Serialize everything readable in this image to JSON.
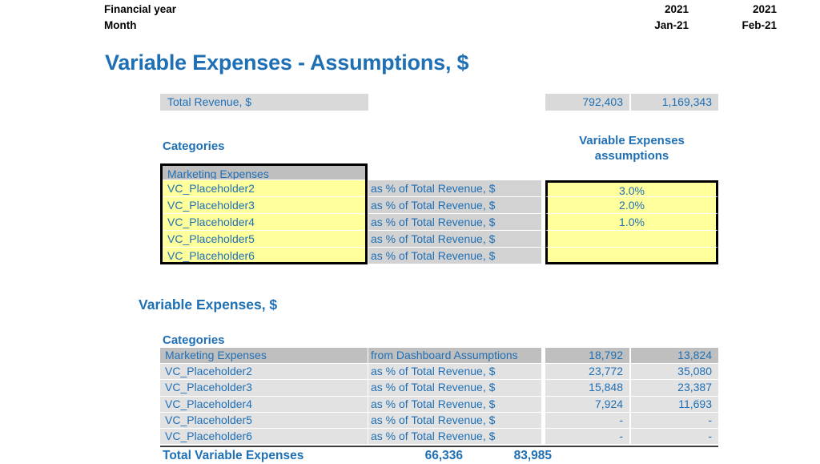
{
  "header": {
    "financial_year_label": "Financial year",
    "month_label": "Month",
    "columns": [
      {
        "year": "2021",
        "month": "Jan-21"
      },
      {
        "year": "2021",
        "month": "Feb-21"
      }
    ]
  },
  "page_title": "Variable Expenses - Assumptions, $",
  "revenue": {
    "label": "Total Revenue, $",
    "values": [
      "792,403",
      "1,169,343"
    ]
  },
  "assumptions": {
    "categories_header": "Categories",
    "values_header_line1": "Variable Expenses",
    "values_header_line2": "assumptions",
    "rows": [
      {
        "name": "Marketing Expenses",
        "basis": "",
        "value": ""
      },
      {
        "name": "VC_Placeholder2",
        "basis": "as % of Total Revenue, $",
        "value": "3.0%"
      },
      {
        "name": "VC_Placeholder3",
        "basis": "as % of Total Revenue, $",
        "value": "2.0%"
      },
      {
        "name": "VC_Placeholder4",
        "basis": "as % of Total Revenue, $",
        "value": "1.0%"
      },
      {
        "name": "VC_Placeholder5",
        "basis": "as % of Total Revenue, $",
        "value": ""
      },
      {
        "name": "VC_Placeholder6",
        "basis": "as % of Total Revenue, $",
        "value": ""
      }
    ]
  },
  "variable_expenses": {
    "section_title": "Variable Expenses, $",
    "categories_header": "Categories",
    "rows": [
      {
        "name": "Marketing Expenses",
        "basis": "from Dashboard Assumptions",
        "v1": "18,792",
        "v2": "13,824"
      },
      {
        "name": "VC_Placeholder2",
        "basis": "as % of Total Revenue, $",
        "v1": "23,772",
        "v2": "35,080"
      },
      {
        "name": "VC_Placeholder3",
        "basis": "as % of Total Revenue, $",
        "v1": "15,848",
        "v2": "23,387"
      },
      {
        "name": "VC_Placeholder4",
        "basis": "as % of Total Revenue, $",
        "v1": "7,924",
        "v2": "11,693"
      },
      {
        "name": "VC_Placeholder5",
        "basis": "as % of Total Revenue, $",
        "v1": "-",
        "v2": "-"
      },
      {
        "name": "VC_Placeholder6",
        "basis": "as % of Total Revenue, $",
        "v1": "-",
        "v2": "-"
      }
    ],
    "total": {
      "label": "Total Variable Expenses",
      "v1": "66,336",
      "v2": "83,985"
    }
  },
  "colors": {
    "accent_blue": "#1F6FB5",
    "input_yellow": "#FFFF9C",
    "header_grey": "#BFBFBF",
    "cell_grey": "#E2E2E2",
    "basis_grey": "#D2D2D2"
  }
}
